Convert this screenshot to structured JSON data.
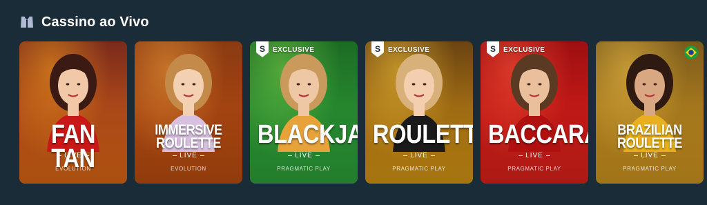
{
  "section": {
    "title": "Cassino ao Vivo",
    "icon": "live-casino-icon"
  },
  "cards": [
    {
      "title": "FAN TAN",
      "live": "LIVE",
      "provider": "EVOLUTION",
      "badge": "",
      "colors": {
        "top": "#7a2a1c",
        "bottom": "#e36a15",
        "glow": "#f7a21b"
      }
    },
    {
      "title": "IMMERSIVE ROULETTE",
      "live": "LIVE",
      "provider": "EVOLUTION",
      "badge": "",
      "colors": {
        "top": "#8a3a12",
        "bottom": "#c04f10",
        "glow": "#f0a03c"
      }
    },
    {
      "title": "BLACKJACK",
      "live": "LIVE",
      "provider": "PRAGMATIC PLAY",
      "badge": "EXCLUSIVE",
      "colors": {
        "top": "#1d6b24",
        "bottom": "#2fa63a",
        "glow": "#7fd24a"
      }
    },
    {
      "title": "ROULETTE",
      "live": "LIVE",
      "provider": "PRAGMATIC PLAY",
      "badge": "EXCLUSIVE",
      "colors": {
        "top": "#6a4312",
        "bottom": "#dc9a14",
        "glow": "#f6c63b"
      }
    },
    {
      "title": "BACCARAT",
      "live": "LIVE",
      "provider": "PRAGMATIC PLAY",
      "badge": "EXCLUSIVE",
      "colors": {
        "top": "#9e0f12",
        "bottom": "#e5231b",
        "glow": "#ff5a3a"
      }
    },
    {
      "title": "BRAZILIAN ROULETTE",
      "live": "LIVE",
      "provider": "PRAGMATIC PLAY",
      "badge": "",
      "flag": "brazil-flag-icon",
      "colors": {
        "top": "#7a5a1b",
        "bottom": "#d69a20",
        "glow": "#f4c44a"
      }
    }
  ]
}
